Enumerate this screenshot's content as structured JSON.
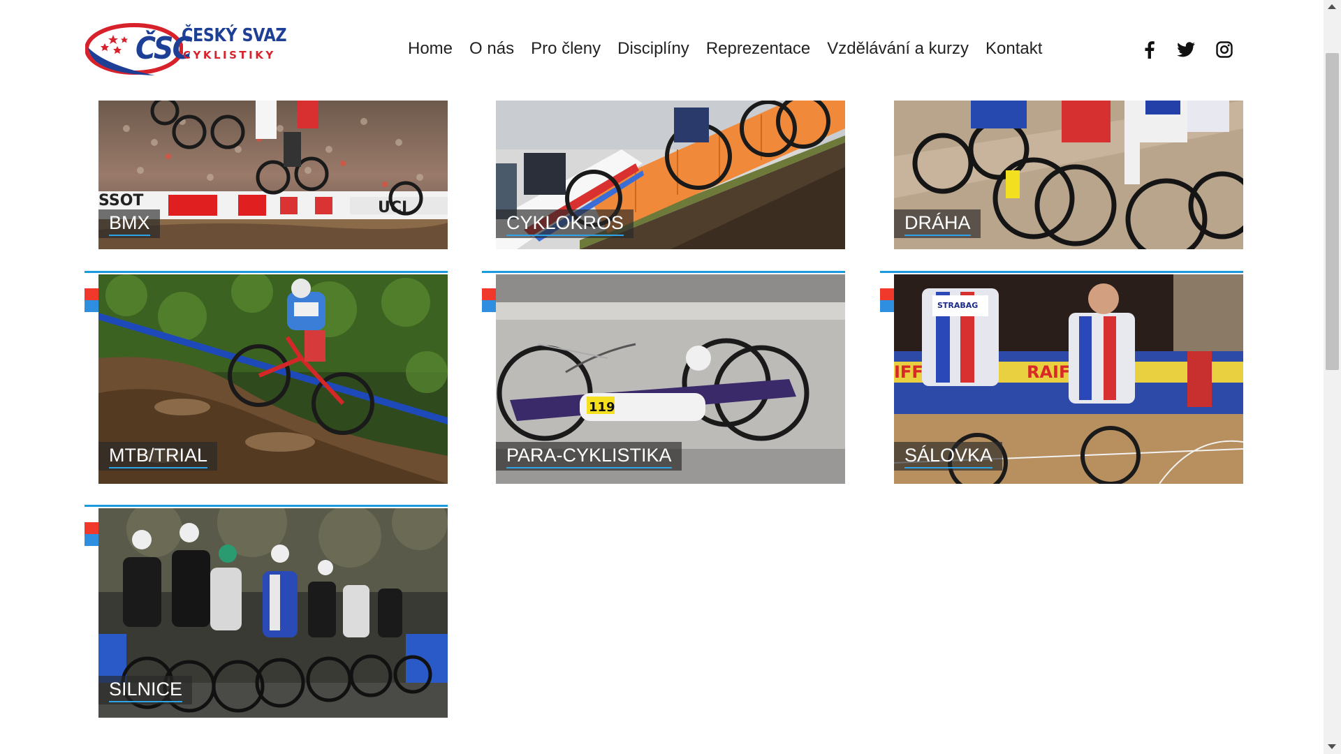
{
  "header": {
    "logo": {
      "abbrev": "ČSC",
      "line1": "ČESKÝ SVAZ",
      "line2": "CYKLISTIKY"
    },
    "nav": [
      {
        "label": "Home"
      },
      {
        "label": "O nás"
      },
      {
        "label": "Pro členy"
      },
      {
        "label": "Disciplíny"
      },
      {
        "label": "Reprezentace"
      },
      {
        "label": "Vzdělávání a kurzy"
      },
      {
        "label": "Kontakt"
      }
    ],
    "social": [
      {
        "icon": "facebook-icon"
      },
      {
        "icon": "twitter-icon"
      },
      {
        "icon": "instagram-icon"
      }
    ]
  },
  "disciplines": [
    {
      "label": "BMX"
    },
    {
      "label": "CYKLOKROS"
    },
    {
      "label": "DRÁHA"
    },
    {
      "label": "MTB/TRIAL"
    },
    {
      "label": "PARA-CYKLISTIKA"
    },
    {
      "label": "SÁLOVKA"
    },
    {
      "label": "SILNICE"
    }
  ],
  "colors": {
    "brand_blue": "#1d3f95",
    "brand_red": "#d8222b",
    "accent_line": "#1a9be0",
    "flag_red": "#f0392b",
    "flag_blue": "#2e8fe0"
  }
}
